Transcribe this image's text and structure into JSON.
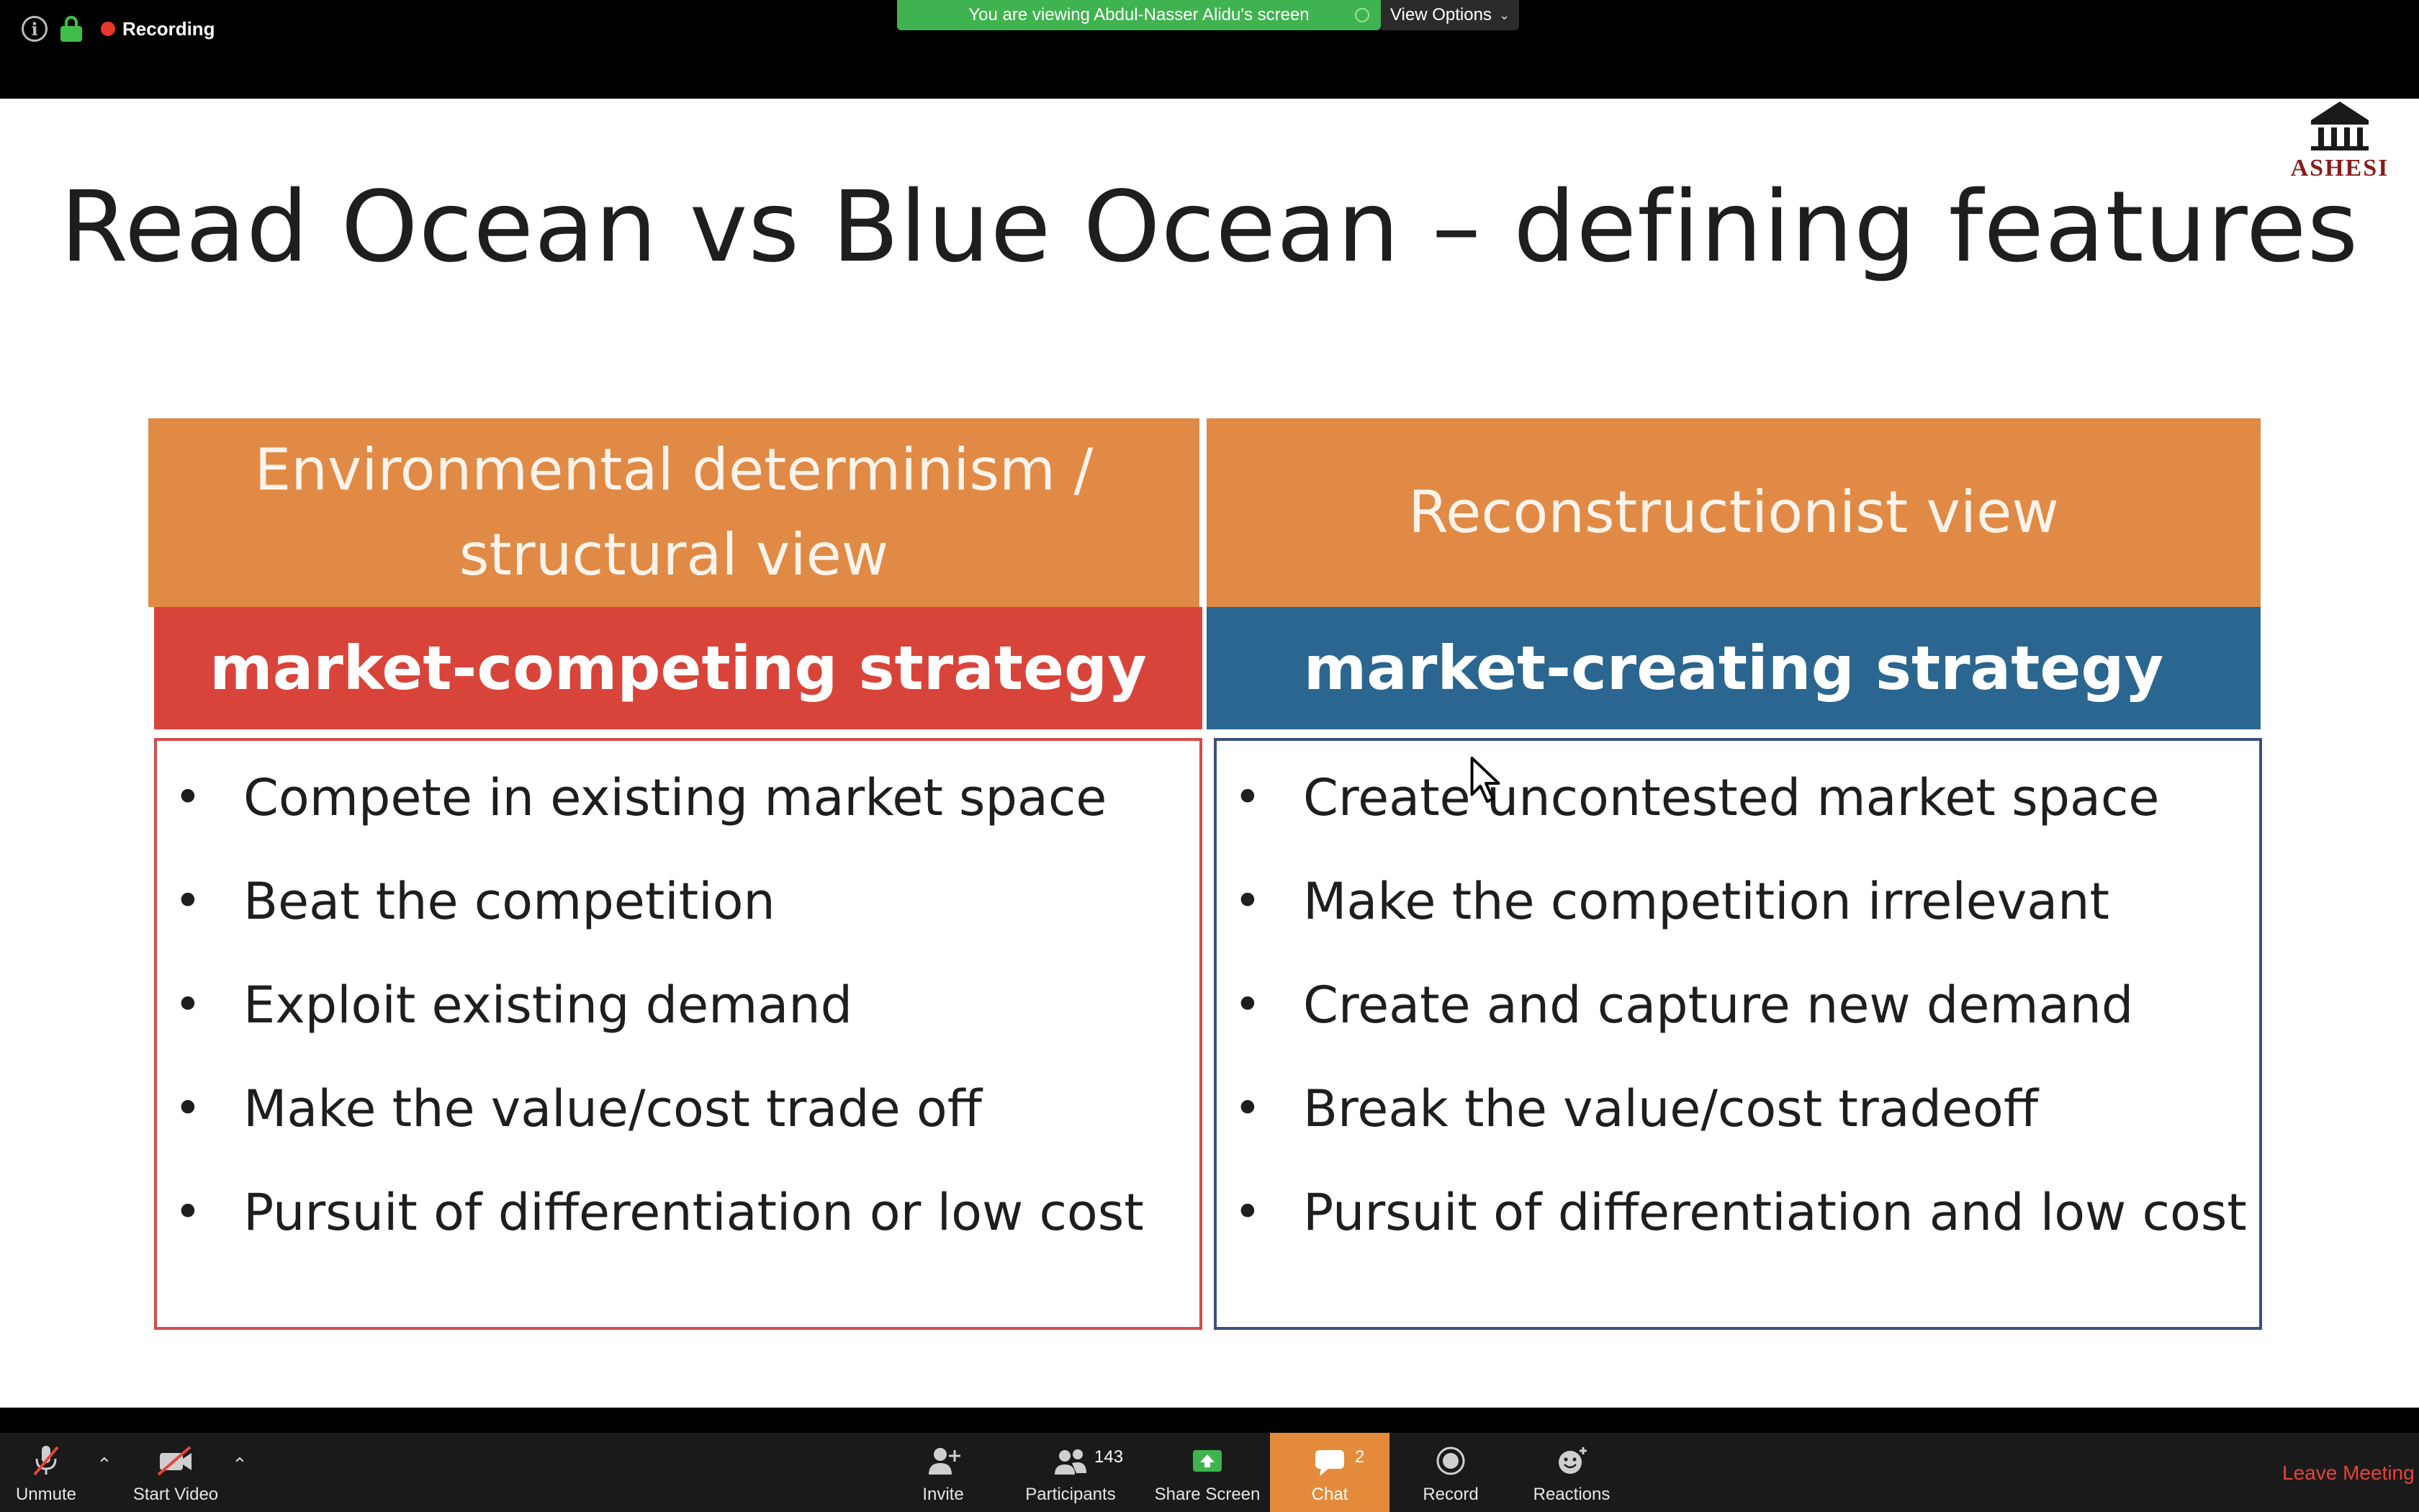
{
  "topbar": {
    "recording_label": "Recording",
    "viewing_banner": "You are viewing Abdul-Nasser Alidu's screen",
    "view_options_label": "View Options"
  },
  "slide": {
    "title": "Read Ocean vs Blue Ocean – defining features",
    "logo_text": "ASHESI",
    "left": {
      "header_line1": "Environmental determinism /",
      "header_line2": "structural view",
      "strategy": "market-competing strategy",
      "bullets": [
        "Compete in existing market space",
        "Beat the competition",
        "Exploit existing demand",
        "Make the value/cost trade off",
        "Pursuit of differentiation or low cost"
      ]
    },
    "right": {
      "header": "Reconstructionist view",
      "strategy": "market-creating strategy",
      "bullets": [
        "Create uncontested market space",
        "Make the competition irrelevant",
        "Create and capture new demand",
        "Break the value/cost tradeoff",
        "Pursuit of differentiation and low cost"
      ]
    }
  },
  "toolbar": {
    "unmute": "Unmute",
    "start_video": "Start Video",
    "invite": "Invite",
    "participants": "Participants",
    "participants_count": "143",
    "share_screen": "Share Screen",
    "chat": "Chat",
    "chat_count": "2",
    "record": "Record",
    "reactions": "Reactions",
    "leave": "Leave Meeting"
  },
  "colors": {
    "slide_header": "#e08a45",
    "competing_strategy": "#d9443a",
    "creating_strategy": "#2a668f",
    "share_green": "#3fb34f",
    "chat_active": "#e38b3b",
    "leave_red": "#e5453a"
  }
}
